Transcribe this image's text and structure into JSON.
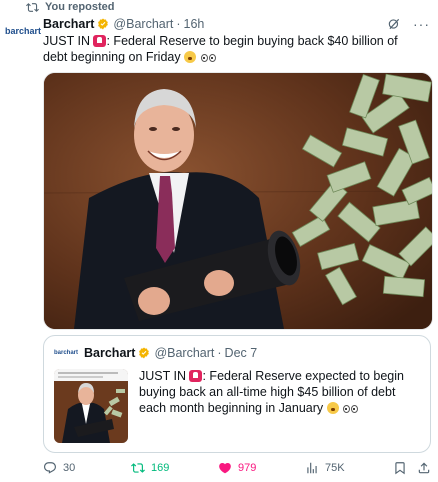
{
  "repost": {
    "label": "You reposted"
  },
  "tweet": {
    "avatar_text": "barchart",
    "name": "Barchart",
    "handle": "@Barchart",
    "separator": "·",
    "time": "16h",
    "text_prefix": "JUST IN",
    "text_body": ": Federal Reserve to begin buying back $40 billion of debt beginning on Friday",
    "verified_color": "#f4b400"
  },
  "quote": {
    "logo_text": "barchart",
    "name": "Barchart",
    "handle": "@Barchart",
    "separator": "·",
    "time": "Dec 7",
    "text_prefix": "JUST IN",
    "text_body": ": Federal Reserve expected to begin buying back an all-time high $45 billion of debt each month beginning in January"
  },
  "actions": {
    "replies": "30",
    "reposts": "169",
    "likes": "979",
    "views": "75K"
  },
  "icons": {
    "repost": "repost-icon",
    "verified": "verified-badge-icon",
    "grok": "grok-icon",
    "more": "more-icon",
    "reply": "reply-icon",
    "like": "heart-icon",
    "views": "views-icon",
    "bookmark": "bookmark-icon",
    "share": "share-icon"
  },
  "colors": {
    "repost_active": "#00ba7c",
    "like_active": "#f91880",
    "muted": "#536471"
  }
}
